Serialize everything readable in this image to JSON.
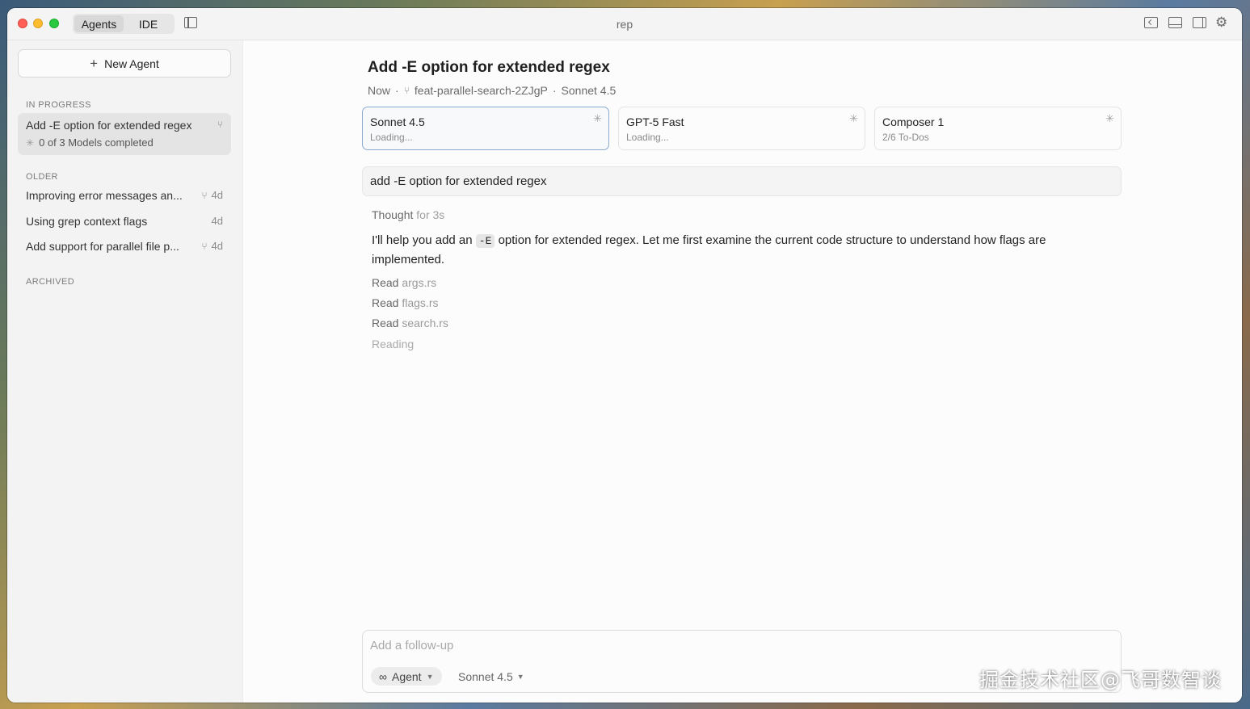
{
  "window": {
    "title": "rep"
  },
  "topbar": {
    "tabs": [
      {
        "label": "Agents",
        "active": true
      },
      {
        "label": "IDE",
        "active": false
      }
    ]
  },
  "sidebar": {
    "new_agent_label": "New Agent",
    "in_progress_heading": "IN PROGRESS",
    "in_progress_item": {
      "title": "Add -E option for extended regex",
      "status": "0 of 3 Models completed"
    },
    "older_heading": "OLDER",
    "older_items": [
      {
        "title": "Improving error messages an...",
        "age": "4d"
      },
      {
        "title": "Using grep context flags",
        "age": "4d"
      },
      {
        "title": "Add support for parallel file p...",
        "age": "4d"
      }
    ],
    "archived_heading": "ARCHIVED"
  },
  "main": {
    "title": "Add -E option for extended regex",
    "meta": {
      "time": "Now",
      "branch": "feat-parallel-search-2ZJgP",
      "model": "Sonnet 4.5"
    },
    "models": [
      {
        "name": "Sonnet 4.5",
        "status": "Loading..."
      },
      {
        "name": "GPT-5 Fast",
        "status": "Loading..."
      },
      {
        "name": "Composer 1",
        "status": "2/6 To-Dos"
      }
    ],
    "prompt": "add -E option for extended regex",
    "thought": {
      "label": "Thought",
      "duration": "for 3s"
    },
    "response": {
      "before": "I'll help you add an ",
      "code": "-E",
      "after": " option for extended regex. Let me first examine the current code structure to understand how flags are implemented."
    },
    "reads": [
      {
        "verb": "Read",
        "file": "args.rs"
      },
      {
        "verb": "Read",
        "file": "flags.rs"
      },
      {
        "verb": "Read",
        "file": "search.rs"
      }
    ],
    "reading_status": "Reading"
  },
  "composer": {
    "placeholder": "Add a follow-up",
    "mode": "Agent",
    "model": "Sonnet 4.5"
  },
  "watermark": "掘金技术社区@飞哥数智谈",
  "colors": {
    "selected_border": "#8aaad0",
    "close": "#fe5f57",
    "minimize": "#febc2e",
    "zoom": "#28c840"
  }
}
